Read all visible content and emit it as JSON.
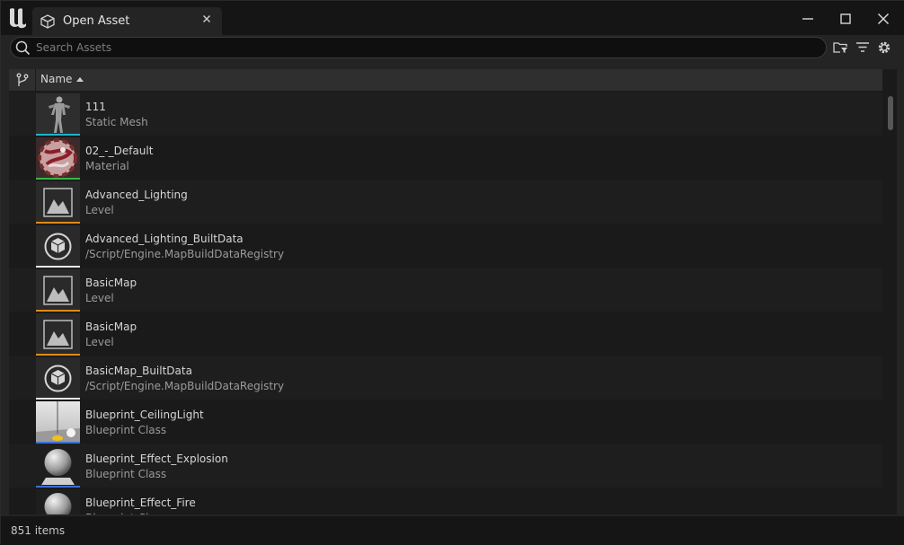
{
  "window": {
    "tab_title": "Open Asset"
  },
  "search": {
    "placeholder": "Search Assets",
    "value": ""
  },
  "list": {
    "column_name": "Name",
    "sort": "ascending",
    "rows": [
      {
        "name": "111",
        "type": "Static Mesh",
        "thumb": "mannequin",
        "bar_color": "#1fb3c9"
      },
      {
        "name": "02_-_Default",
        "type": "Material",
        "thumb": "material-ball",
        "bar_color": "#37b34a"
      },
      {
        "name": "Advanced_Lighting",
        "type": "Level",
        "thumb": "level-icon",
        "bar_color": "#e08a18"
      },
      {
        "name": "Advanced_Lighting_BuiltData",
        "type": "/Script/Engine.MapBuildDataRegistry",
        "thumb": "cube-icon",
        "bar_color": "#e8e8e8"
      },
      {
        "name": "BasicMap",
        "type": "Level",
        "thumb": "level-icon",
        "bar_color": "#e08a18"
      },
      {
        "name": "BasicMap",
        "type": "Level",
        "thumb": "level-icon",
        "bar_color": "#e08a18"
      },
      {
        "name": "BasicMap_BuiltData",
        "type": "/Script/Engine.MapBuildDataRegistry",
        "thumb": "cube-icon",
        "bar_color": "#e8e8e8"
      },
      {
        "name": "Blueprint_CeilingLight",
        "type": "Blueprint Class",
        "thumb": "ceiling-light",
        "bar_color": "#3a6fd8"
      },
      {
        "name": "Blueprint_Effect_Explosion",
        "type": "Blueprint Class",
        "thumb": "sphere-pedestal",
        "bar_color": "#3a6fd8"
      },
      {
        "name": "Blueprint_Effect_Fire",
        "type": "Blueprint Class",
        "thumb": "sphere-pedestal",
        "bar_color": "#3a6fd8"
      }
    ]
  },
  "status": {
    "count_text": "851 items"
  },
  "colors": {
    "background": "#151515",
    "panel": "#242424",
    "accent_mesh": "#1fb3c9",
    "accent_material": "#37b34a",
    "accent_level": "#e08a18",
    "accent_blueprint": "#3a6fd8"
  }
}
